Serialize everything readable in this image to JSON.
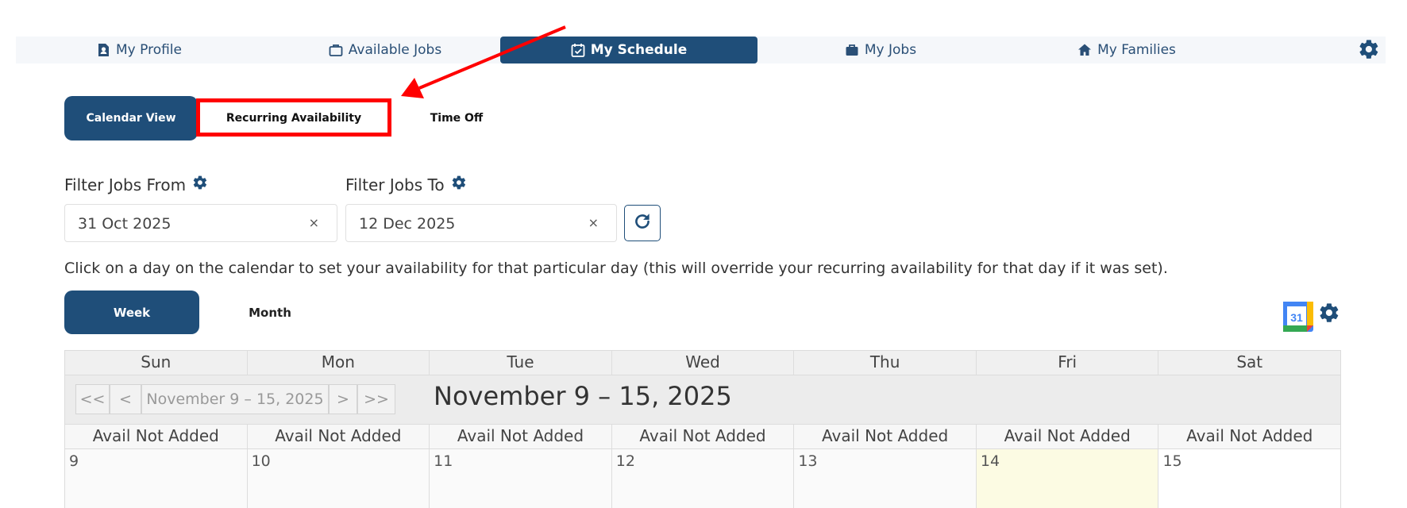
{
  "nav": {
    "items": [
      {
        "label": "My Profile",
        "icon": "profile-icon"
      },
      {
        "label": "Available Jobs",
        "icon": "briefcase-outline-icon"
      },
      {
        "label": "My Schedule",
        "icon": "calendar-check-icon",
        "active": true
      },
      {
        "label": "My Jobs",
        "icon": "briefcase-icon"
      },
      {
        "label": "My Families",
        "icon": "home-icon"
      }
    ],
    "settings_icon": "gear-icon"
  },
  "subtabs": [
    {
      "label": "Calendar View",
      "active": true
    },
    {
      "label": "Recurring Availability",
      "highlighted": true
    },
    {
      "label": "Time Off"
    }
  ],
  "filters": {
    "from_label": "Filter Jobs From",
    "from_value": "31 Oct 2025",
    "to_label": "Filter Jobs To",
    "to_value": "12 Dec 2025",
    "clear_glyph": "×"
  },
  "instructions": "Click on a day on the calendar to set your availability for that particular day (this will override your recurring availability for that day if it was set).",
  "views": {
    "week": "Week",
    "month": "Month",
    "active": "Week"
  },
  "gcal_icon_text": "31",
  "calendar": {
    "weekdays": [
      "Sun",
      "Mon",
      "Tue",
      "Wed",
      "Thu",
      "Fri",
      "Sat"
    ],
    "pager": {
      "first": "<<",
      "prev": "<",
      "current": "November 9 – 15, 2025",
      "next": ">",
      "last": ">>"
    },
    "range_title": "November 9 – 15, 2025",
    "availability": [
      "Avail Not Added",
      "Avail Not Added",
      "Avail Not Added",
      "Avail Not Added",
      "Avail Not Added",
      "Avail Not Added",
      "Avail Not Added"
    ],
    "days": [
      "9",
      "10",
      "11",
      "12",
      "13",
      "14",
      "15"
    ],
    "today_index": 5
  },
  "colors": {
    "primary": "#1f4e79",
    "highlight": "#ff0000",
    "today_bg": "#fcfbe3",
    "nav_bg": "#f5f7fa"
  }
}
